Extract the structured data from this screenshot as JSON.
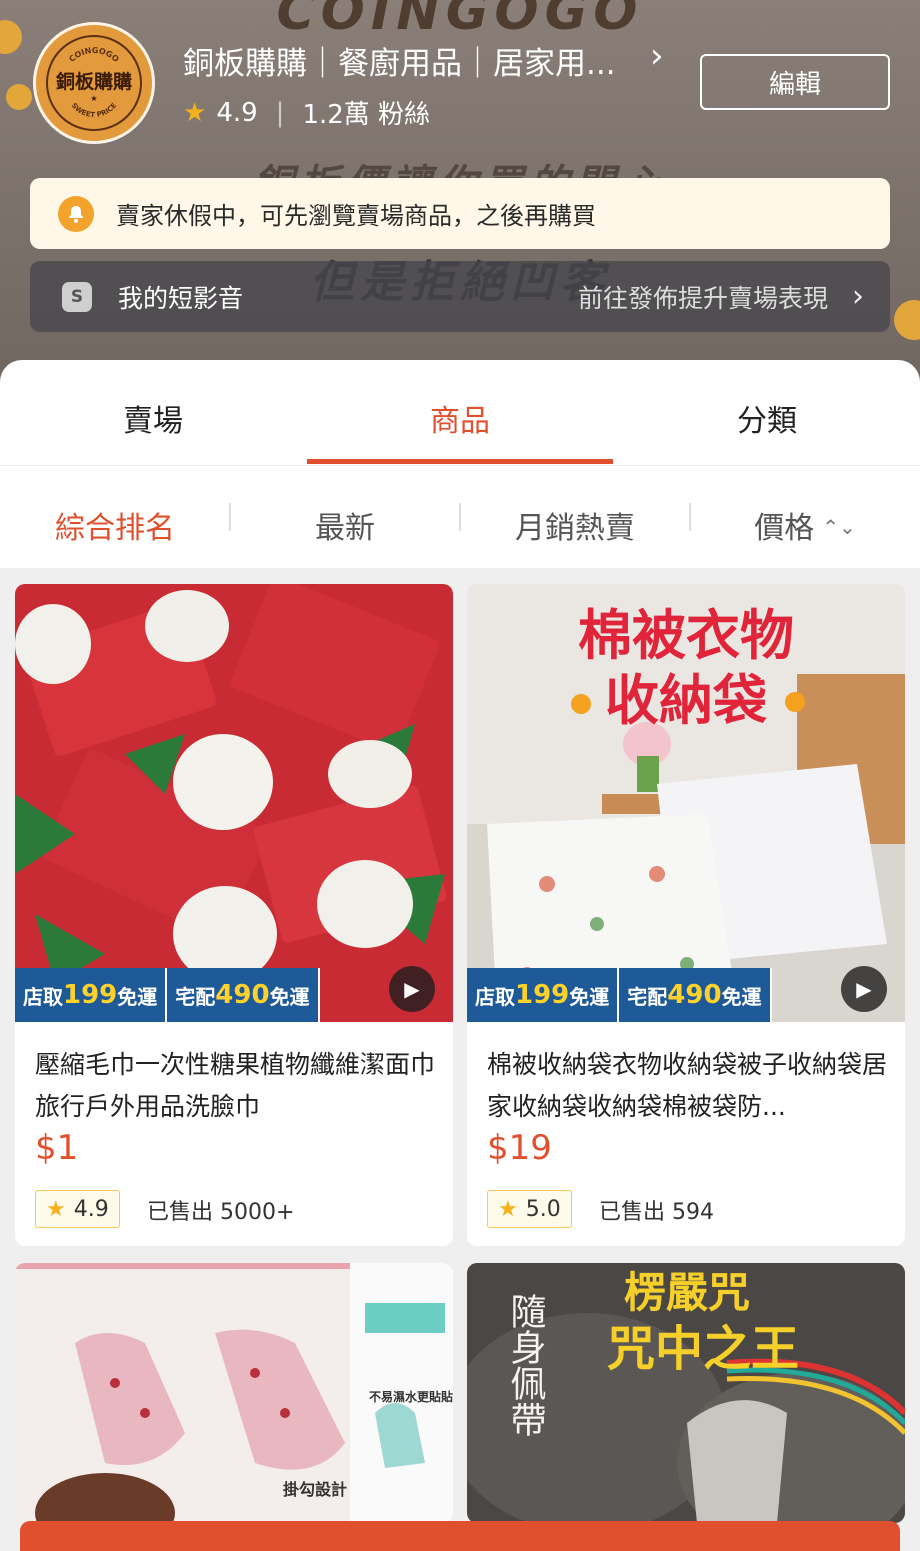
{
  "shop": {
    "banner_brand": "COINGOGO",
    "banner_line1": "銅板價讓你買的開心",
    "banner_line2": "但是拒絕凹客",
    "logo_text": "銅板購購",
    "logo_top": "COINGOGO",
    "logo_bottom": "SWEET PRICE",
    "name": "銅板購購｜餐廚用品｜居家用...",
    "rating": "4.9",
    "followers": "1.2萬 粉絲",
    "edit_label": "編輯"
  },
  "notice": {
    "text": "賣家休假中，可先瀏覽賣場商品，之後再購買",
    "icon": "bell-icon"
  },
  "video_bar": {
    "label": "我的短影音",
    "right_text": "前往發佈提升賣場表現",
    "icon": "shorts-icon"
  },
  "tabs": [
    {
      "label": "賣場"
    },
    {
      "label": "商品"
    },
    {
      "label": "分類"
    }
  ],
  "sort": {
    "items": [
      {
        "label": "綜合排名"
      },
      {
        "label": "最新"
      },
      {
        "label": "月銷熱賣"
      },
      {
        "label": "價格"
      }
    ]
  },
  "promo": {
    "pickup_prefix": "店取",
    "pickup_amount": "199",
    "pickup_suffix": "免運",
    "delivery_prefix": "宅配",
    "delivery_amount": "490",
    "delivery_suffix": "免運"
  },
  "products": [
    {
      "title": "壓縮毛巾一次性糖果植物纖維潔面巾旅行戶外用品洗臉巾",
      "price": "$1",
      "rating": "4.9",
      "sold": "已售出 5000+"
    },
    {
      "title": "棉被收納袋衣物收納袋被子收納袋居家收納袋收納袋棉被袋防...",
      "price": "$19",
      "rating": "5.0",
      "sold": "已售出 594",
      "image_text_1": "棉被衣物",
      "image_text_2": "收納袋"
    },
    {
      "image_text_1": "不易濕水更貼貼",
      "image_text_2": "掛勾設計"
    },
    {
      "image_text_1": "楞嚴咒",
      "image_text_2": "咒中之王",
      "image_text_3": "隨身佩帶"
    }
  ],
  "colors": {
    "accent": "#e0502e",
    "promo_blue": "#1f5a98",
    "star": "#f6b21e"
  }
}
